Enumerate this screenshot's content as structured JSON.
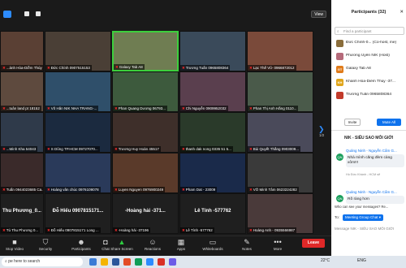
{
  "toolbar": {
    "view_label": "View",
    "items": [
      {
        "label": "Stop Video"
      },
      {
        "label": "Security"
      },
      {
        "label": "Participants",
        "count": "32"
      },
      {
        "label": "Chat"
      },
      {
        "label": "Share Screen"
      },
      {
        "label": "Reactions"
      },
      {
        "label": "Apps"
      },
      {
        "label": "Whiteboards"
      },
      {
        "label": "Notes"
      },
      {
        "label": "More"
      }
    ],
    "leave_label": "Leave"
  },
  "tiles": [
    {
      "name": "...ánh Hòa-Diễm Thúy -3724..."
    },
    {
      "name": "Đức Chính 0907515153"
    },
    {
      "name": "Galaxy Tab A8"
    },
    {
      "name": "Trương Tuấn 0965808364"
    },
    {
      "name": "Lạc Thế Vũ- 0966872012"
    },
    {
      "name": "...tuân land pt 18152"
    },
    {
      "name": "Võ Hân NIK NHA TRANG-..."
    },
    {
      "name": "Phan Quang Dương 06793..."
    },
    {
      "name": "Chi Nguyễn 0909952032"
    },
    {
      "name": "Phan Thị Anh Hằng 0110..."
    },
    {
      "name": "...Minh Kha 54043"
    },
    {
      "name": "S Dũng TP.HCM 09727070..."
    },
    {
      "name": "Trương Huy Hoàn 45517"
    },
    {
      "name": "thanh dak nong 0335 51 5..."
    },
    {
      "name": "Bùi Quyết Thắng 0903009..."
    },
    {
      "name": "Tuấn 0944023685 Ca..."
    },
    {
      "name": "Hoàng vân chúc 0976109078"
    },
    {
      "name": "Luyen Nguyen 0976900249"
    },
    {
      "name": "Pham Dat - 23009"
    },
    {
      "name": "VÕ Minh Tâm 0623224282"
    },
    {
      "name": "Tú Thu Phương 0...",
      "big": "Thu Phương_0..."
    },
    {
      "name": "Đỗ Hiếu 0907815171 Long ...",
      "big": "Đỗ Hiếu 0907815171..."
    },
    {
      "name": "-Hoàng hải -37196",
      "big": "-Hoàng hải -371..."
    },
    {
      "name": "Lê Tính -577762",
      "big": "Lê Tính -577762"
    },
    {
      "name": "Hoàng Anh - 0935566987"
    }
  ],
  "pager": {
    "arrow": "❯",
    "page": "1/2"
  },
  "panel": {
    "title": "Participants (32)",
    "close": "✕",
    "search_placeholder": "Find a participant",
    "participants": [
      {
        "name": "Đức Chính-0... (Co-host, me)",
        "color": "#8a6d3b",
        "initials": ""
      },
      {
        "name": "Phương Uyên NIK (Host)",
        "color": "#b56a7a",
        "initials": ""
      },
      {
        "name": "Galaxy Tab A8",
        "color": "#e07b1a",
        "initials": "GT"
      },
      {
        "name": "Khánh Hòa-Diễm Thúy -37...",
        "color": "#e0a51a",
        "initials": "KH"
      },
      {
        "name": "Trương Tuấn 0965808364",
        "color": "#c23a2a",
        "initials": ""
      }
    ],
    "invite_label": "Invite",
    "mute_all_label": "Mute All",
    "chat_title": "NIK - SIÊU SAO MÔI GIỚI",
    "messages": [
      {
        "from": "Quảng Ninh - Nguyễn Cẩm G...",
        "initials": "QN",
        "text": "Nhà mình căng đèm càng xôm!!!"
      },
      {
        "from": "Quảng Ninh - Nguyễn Cẩm G...",
        "initials": "QN",
        "text": "Rõ ràng hơn"
      }
    ],
    "small_note": "Hồ Đức Khánh - HCM sẽ",
    "who_can_see": "Who can see your messages? Re...",
    "to_label": "To:",
    "to_target": "Meeting Group Chat ▾",
    "message_placeholder": "Message NIK - SIÊU SAO MÔI GIỚI"
  },
  "taskbar": {
    "search_label": "pe here to search",
    "time": "22°C",
    "lang": "ENG"
  }
}
